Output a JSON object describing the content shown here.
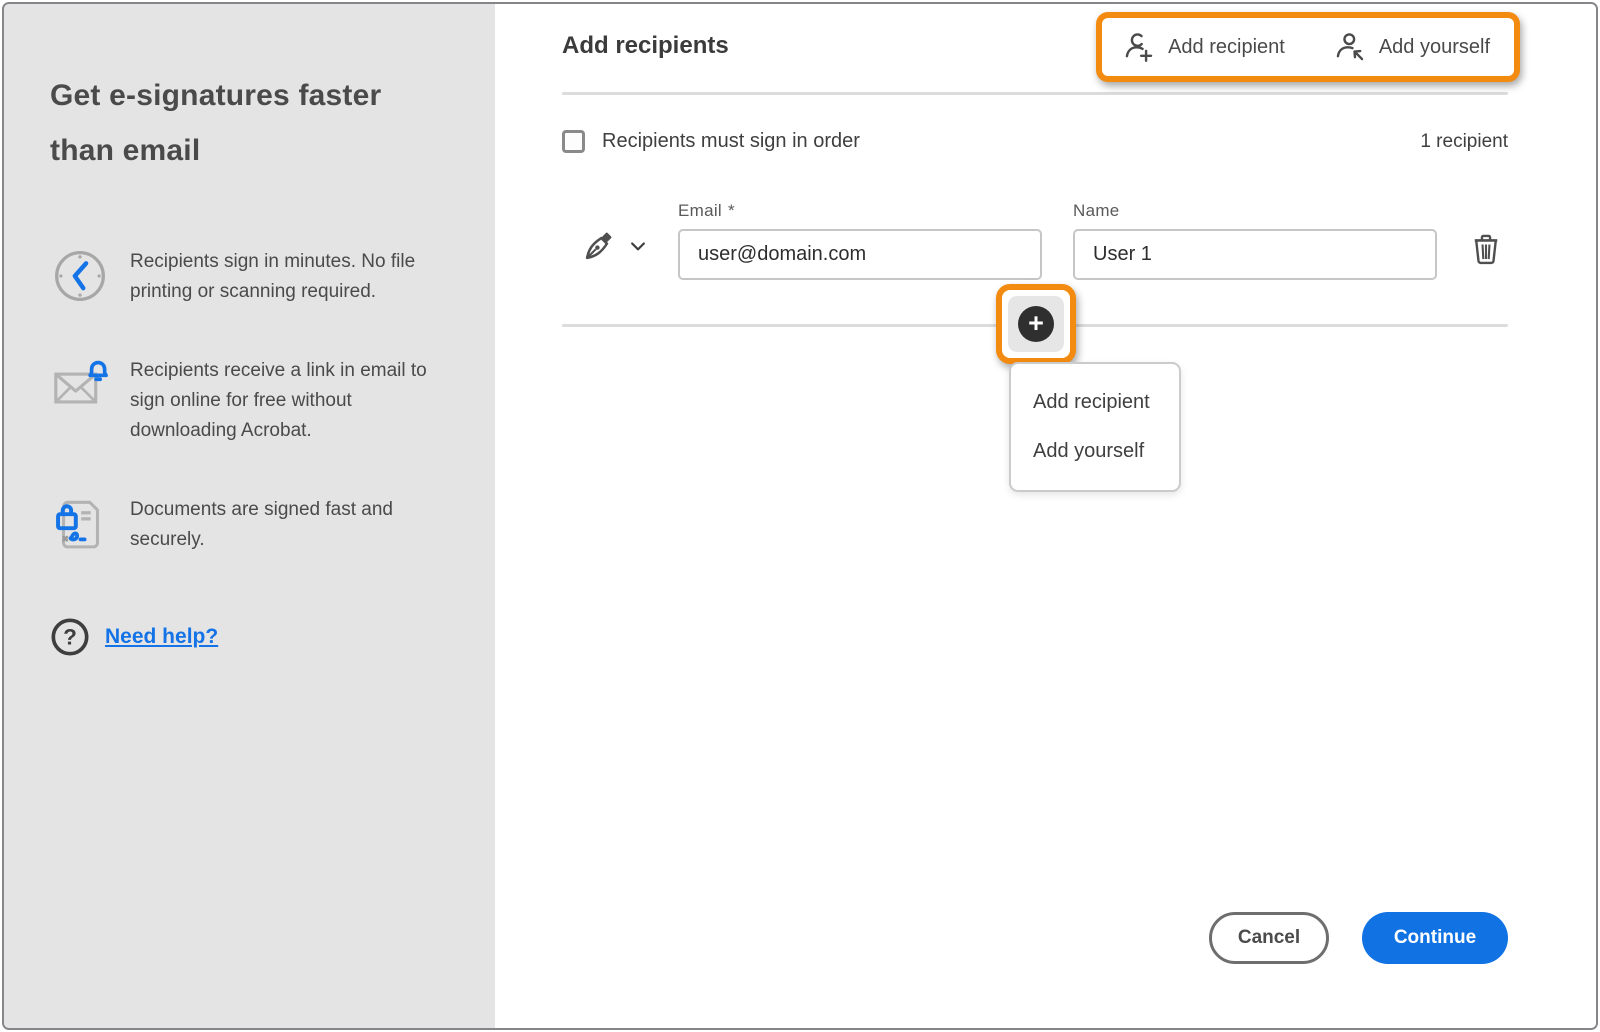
{
  "sidebar": {
    "heading": "Get e-signatures faster than email",
    "benefits": [
      {
        "icon": "clock-icon",
        "text": "Recipients sign in minutes. No file printing or scanning required."
      },
      {
        "icon": "email-notification-icon",
        "text": "Recipients receive a link in email to sign online for free without downloading Acrobat."
      },
      {
        "icon": "secure-document-icon",
        "text": "Documents are signed fast and securely."
      }
    ],
    "help_link_label": "Need help?"
  },
  "header": {
    "title": "Add recipients",
    "add_recipient_label": "Add recipient",
    "add_yourself_label": "Add yourself"
  },
  "recipients": {
    "sign_in_order_label": "Recipients must sign in order",
    "sign_in_order_checked": false,
    "count_label": "1 recipient",
    "rows": [
      {
        "email_label": "Email",
        "email_required_mark": "*",
        "email_value": "user@domain.com",
        "name_label": "Name",
        "name_value": "User 1"
      }
    ]
  },
  "add_menu": {
    "items": [
      "Add recipient",
      "Add yourself"
    ]
  },
  "footer": {
    "cancel_label": "Cancel",
    "continue_label": "Continue"
  },
  "colors": {
    "accent_blue": "#1473E6",
    "continue_blue": "#1172E4",
    "highlight_orange": "#F28B10",
    "sidebar_gray": "#E4E4E4",
    "text_dark": "#3F3F3F"
  }
}
